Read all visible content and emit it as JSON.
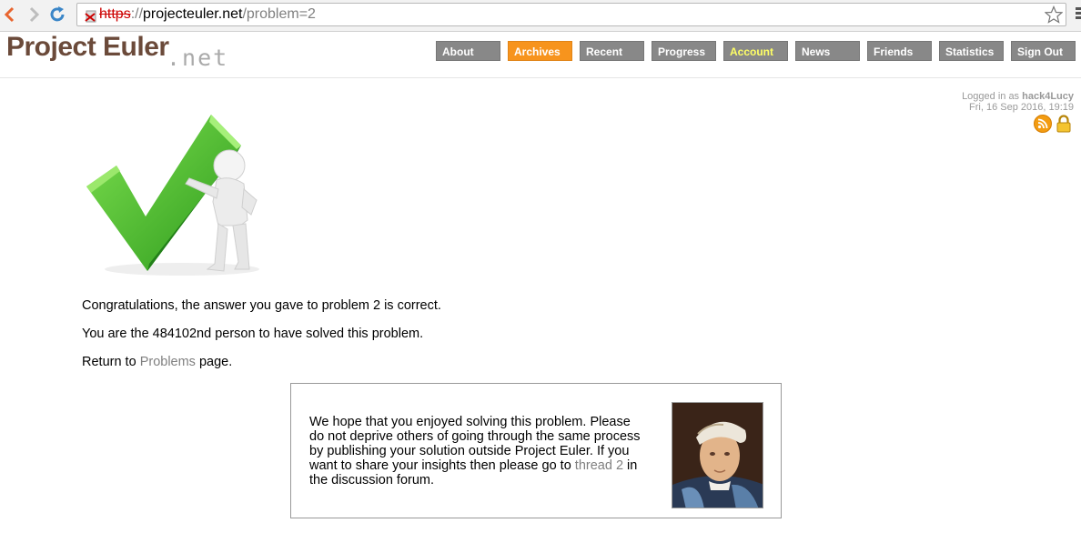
{
  "browser": {
    "url_scheme": "https",
    "url_separator": "://",
    "url_host": "projecteuler.net",
    "url_path": "/problem=2"
  },
  "header": {
    "logo_text": "Project Euler",
    "logo_suffix": ".net",
    "nav": [
      {
        "label": "About"
      },
      {
        "label": "Archives"
      },
      {
        "label": "Recent"
      },
      {
        "label": "Progress"
      },
      {
        "label": "Account"
      },
      {
        "label": "News"
      },
      {
        "label": "Friends"
      },
      {
        "label": "Statistics"
      },
      {
        "label": "Sign Out"
      }
    ]
  },
  "user": {
    "logged_in_prefix": "Logged in as",
    "username": "hack4Lucy",
    "datetime": "Fri, 16 Sep 2016, 19:19"
  },
  "main": {
    "congrats": "Congratulations, the answer you gave to problem 2 is correct.",
    "position_text": "You are the 484102nd person to have solved this problem.",
    "return_prefix": "Return to",
    "return_link": "Problems",
    "return_suffix": "page."
  },
  "infobox": {
    "text_before": "We hope that you enjoyed solving this problem. Please do not deprive others of going through the same process by publishing your solution outside Project Euler. If you want to share your insights then please go to",
    "thread_link": "thread 2",
    "text_after": "in the discussion forum."
  },
  "colors": {
    "archives_highlight": "#f7941d",
    "account_text": "#ffff66",
    "logo_brown": "#6b4a3a"
  },
  "icons": [
    "back-arrow-icon",
    "forward-arrow-icon",
    "reload-icon",
    "insecure-lock-icon",
    "star-icon",
    "chrome-menu-icon",
    "rss-icon",
    "lock-icon",
    "checkmark-figure-image",
    "euler-portrait-image"
  ]
}
